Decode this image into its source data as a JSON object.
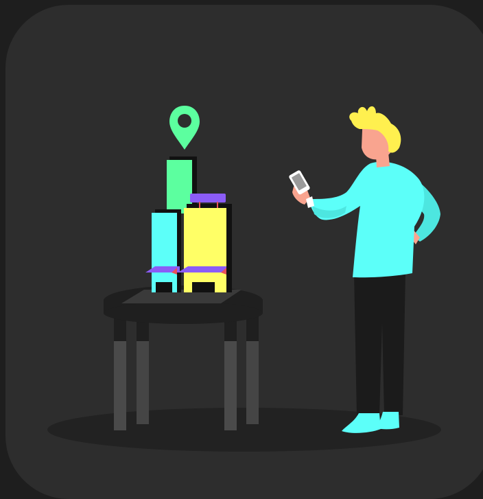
{
  "illustration": {
    "icons": [
      "location-pin-icon",
      "smartphone-icon"
    ],
    "colors": {
      "page_background": "#1e1e1e",
      "card_background": "#2d2d2d",
      "ground_shadow": "#222222",
      "table_top": "#1f1f1f",
      "table_legs": "#4a4a4a",
      "pin_green": "#5cff9f",
      "tower_green": "#5cff9f",
      "tower_cyan": "#5cfff9",
      "tower_yellow": "#ffff66",
      "accent_purple": "#8b5cf6",
      "accent_red": "#e8505b",
      "person_shirt": "#5cfff9",
      "person_hair": "#fff04f",
      "person_skin": "#f9a48f",
      "person_pants": "#1b1b1b",
      "person_shoes": "#5cfff9",
      "phone_body": "#ffffff",
      "phone_screen": "#9a9a9a"
    }
  }
}
